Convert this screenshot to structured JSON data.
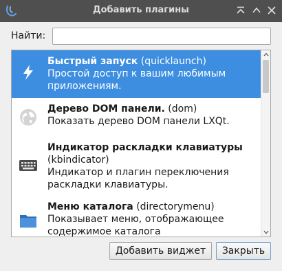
{
  "window": {
    "title": "Добавить плагины"
  },
  "search": {
    "label": "Найти:",
    "value": "",
    "placeholder": ""
  },
  "plugins": [
    {
      "name": "Быстрый запуск",
      "id": "(quicklaunch)",
      "description": "Простой доступ к вашим любимым приложениям.",
      "icon": "lightning-icon",
      "selected": true
    },
    {
      "name": "Дерево DOM панели.",
      "id": "(dom)",
      "description": "Показать дерево DOM панели LXQt.",
      "icon": "globe-icon",
      "selected": false
    },
    {
      "name": "Индикатор раскладки клавиатуры",
      "id": "(kbindicator)",
      "description": "Индикатор и плагин переключения раскладки клавиатуры.",
      "icon": "keyboard-icon",
      "selected": false
    },
    {
      "name": "Меню каталога",
      "id": "(directorymenu)",
      "description": "Показывает меню, отображающее содержимое каталога",
      "icon": "folder-icon",
      "selected": false
    }
  ],
  "buttons": {
    "add": "Добавить виджет",
    "close": "Закрыть"
  },
  "colors": {
    "titlebar": "#4f4f4f",
    "selection": "#3d8ee0",
    "dialog": "#efefef"
  }
}
